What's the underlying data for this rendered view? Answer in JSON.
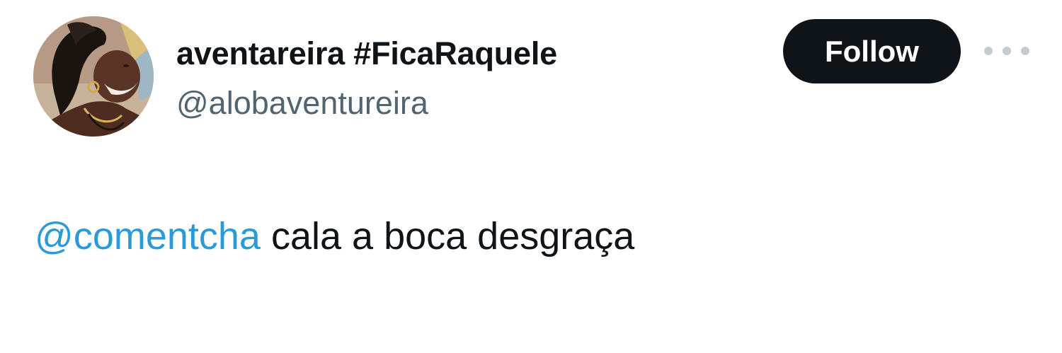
{
  "author": {
    "display_name": "aventareira #FicaRaquele",
    "handle": "@alobaventureira",
    "avatar_alt": "profile photo"
  },
  "actions": {
    "follow_label": "Follow",
    "more_icon": "more-dots-icon"
  },
  "tweet": {
    "mention": "@comentcha",
    "text": " cala a boca desgraça"
  },
  "colors": {
    "text": "#0f1419",
    "secondary": "#536471",
    "link": "#2b9ad9",
    "follow_bg": "#0f1419",
    "follow_text": "#ffffff"
  }
}
